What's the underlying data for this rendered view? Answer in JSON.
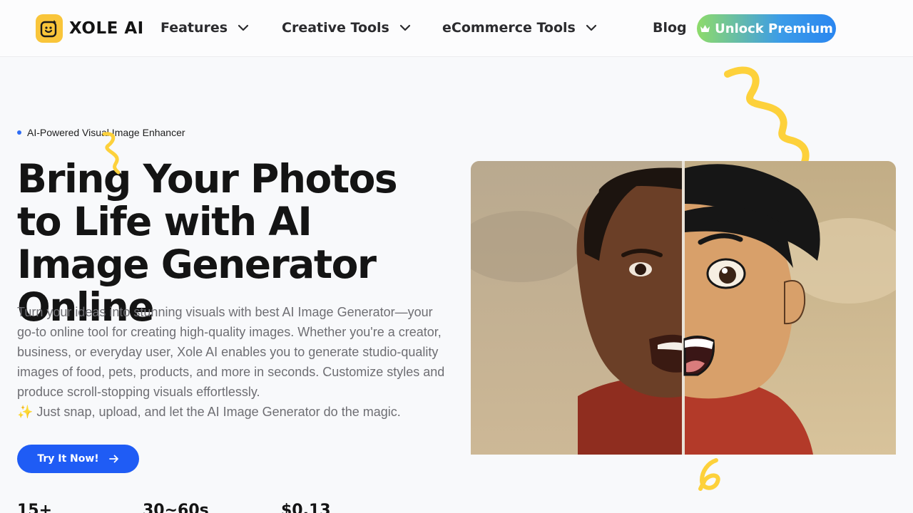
{
  "header": {
    "logo_text": "XOLE AI",
    "nav": [
      {
        "label": "Features",
        "dropdown": true
      },
      {
        "label": "Creative Tools",
        "dropdown": true
      },
      {
        "label": "eCommerce Tools",
        "dropdown": true
      },
      {
        "label": "Blog",
        "dropdown": false
      }
    ],
    "premium_label": "Unlock Premium"
  },
  "hero": {
    "badge": "AI-Powered Visual Image Enhancer",
    "title": "Bring Your Photos to Life with AI Image Generator Online",
    "description": "Turn your ideas into stunning visuals with best AI Image Generator—your go-to online tool for creating high-quality images. Whether you're a creator, business, or everyday user, Xole AI enables you to generate studio-quality images of food, pets, products, and more in seconds. Customize styles and produce scroll-stopping visuals effortlessly.",
    "tagline": "✨ Just snap, upload, and let the AI Image Generator do the magic.",
    "cta_label": "Try It Now!",
    "stats": [
      "15+",
      "30~60s",
      "$0.13"
    ]
  },
  "colors": {
    "accent_blue": "#1f5cf5",
    "logo_yellow": "#f9c53a",
    "squiggle_yellow": "#fdd13b"
  },
  "icons": [
    "logo-face-icon",
    "chevron-down-icon",
    "crown-icon",
    "arrow-right-icon"
  ]
}
